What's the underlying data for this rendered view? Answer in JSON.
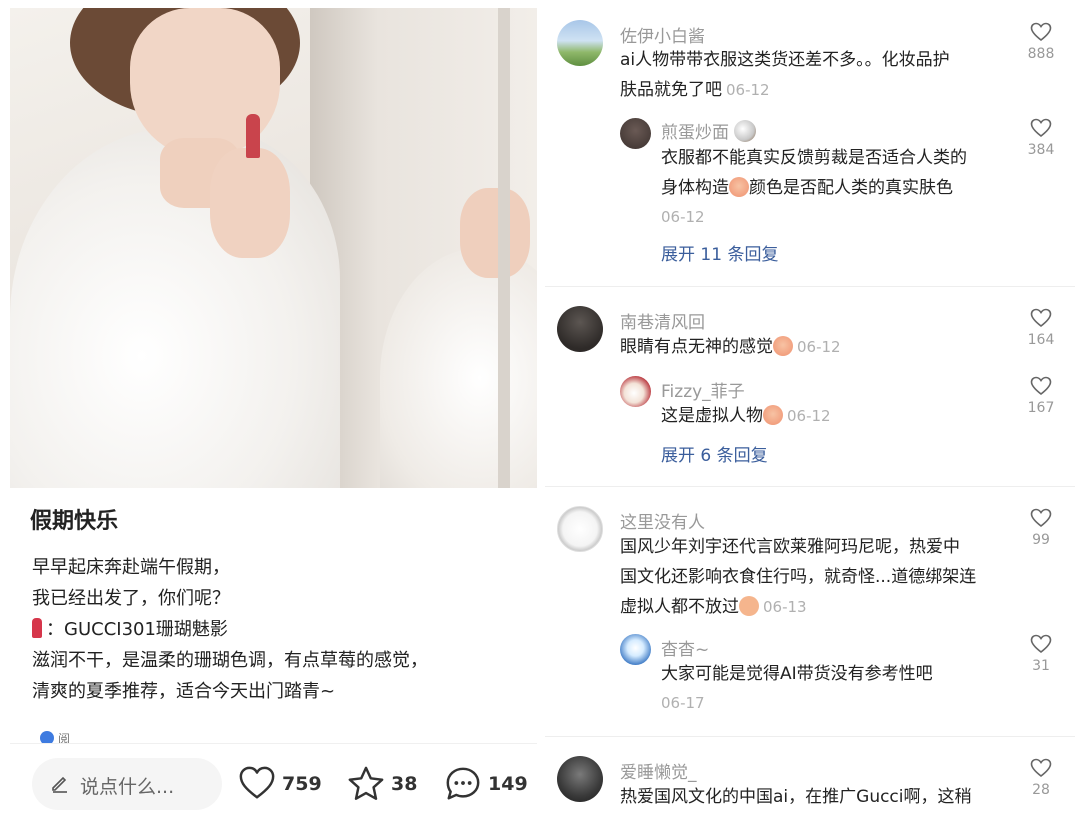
{
  "post": {
    "title": "假期快乐",
    "body_lines": [
      "早早起床奔赴端午假期，",
      "我已经出发了，你们呢？",
      "：GUCCI301珊瑚魅影",
      "滋润不干，是温柔的珊瑚色调，有点草莓的感觉，",
      "清爽的夏季推荐，适合今天出门踏青~"
    ],
    "lipstick_icon": "lipstick-emoji",
    "tag_peek": "阅"
  },
  "bottom_bar": {
    "say_placeholder": "说点什么...",
    "likes": "759",
    "stars": "38",
    "comments": "149"
  },
  "comments": [
    {
      "user": "佐伊小白酱",
      "lines": [
        "ai人物带带衣服这类货还差不多。。化妆品护",
        "肤品就免了吧"
      ],
      "date": "06-12",
      "likes": "888",
      "reply": {
        "user": "煎蛋炒面",
        "lines": [
          "衣服都不能真实反馈剪裁是否适合人类的",
          "身体构造",
          "颜色是否配人类的真实肤色"
        ],
        "date": "06-12",
        "likes": "384"
      },
      "expand": "展开 11 条回复"
    },
    {
      "user": "南巷清风回",
      "lines": [
        "眼睛有点无神的感觉"
      ],
      "date": "06-12",
      "likes": "164",
      "reply": {
        "user": "Fizzy_菲子",
        "lines": [
          "这是虚拟人物"
        ],
        "date": "06-12",
        "likes": "167"
      },
      "expand": "展开 6 条回复"
    },
    {
      "user": "这里没有人",
      "lines": [
        "国风少年刘宇还代言欧莱雅阿玛尼呢，热爱中",
        "国文化还影响衣食住行吗，就奇怪...道德绑架连",
        "虚拟人都不放过"
      ],
      "date": "06-13",
      "likes": "99",
      "reply": {
        "user": "杳杳~",
        "lines": [
          "大家可能是觉得AI带货没有参考性吧"
        ],
        "date": "06-17",
        "likes": "31"
      }
    },
    {
      "user": "爱睡懒觉_",
      "lines": [
        "热爱国风文化的中国ai，在推广Gucci啊，这稍"
      ],
      "likes": "28"
    }
  ],
  "colors": {
    "expand_link": "#3b5e9c",
    "username": "#999999",
    "date": "#b0b0b0"
  }
}
